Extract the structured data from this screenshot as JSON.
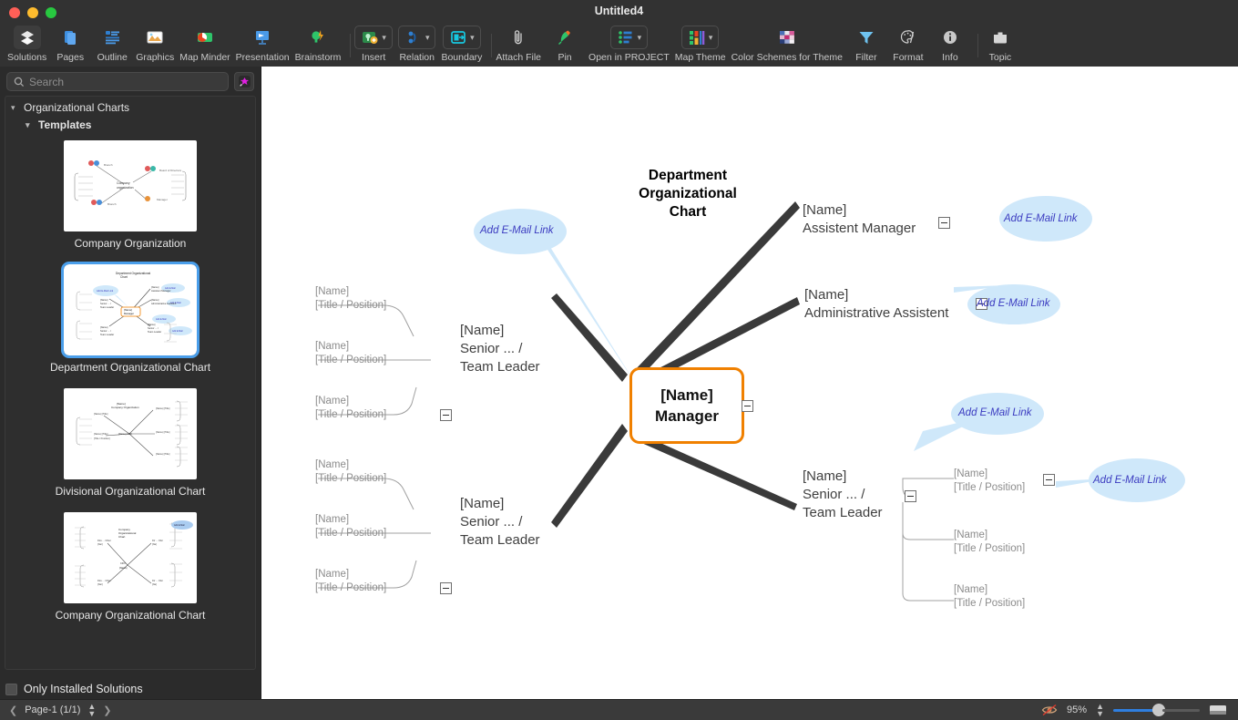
{
  "window": {
    "title": "Untitled4"
  },
  "toolbar": {
    "items": [
      {
        "label": "Solutions",
        "icon": "solutions-icon",
        "active": true,
        "chevron": false
      },
      {
        "label": "Pages",
        "icon": "pages-icon",
        "active": false,
        "chevron": false
      },
      {
        "label": "Outline",
        "icon": "outline-icon",
        "active": false,
        "chevron": false
      },
      {
        "label": "Graphics",
        "icon": "graphics-icon",
        "active": false,
        "chevron": false
      },
      {
        "label": "Map Minder",
        "icon": "map-minder-icon",
        "active": false,
        "chevron": false
      },
      {
        "label": "Presentation",
        "icon": "presentation-icon",
        "active": false,
        "chevron": false
      },
      {
        "label": "Brainstorm",
        "icon": "brainstorm-icon",
        "active": false,
        "chevron": false
      },
      {
        "label": "Insert",
        "icon": "insert-icon",
        "active": false,
        "chevron": true
      },
      {
        "label": "Relation",
        "icon": "relation-icon",
        "active": false,
        "chevron": true
      },
      {
        "label": "Boundary",
        "icon": "boundary-icon",
        "active": false,
        "chevron": true
      },
      {
        "label": "Attach File",
        "icon": "paperclip-icon",
        "active": false,
        "chevron": false
      },
      {
        "label": "Pin",
        "icon": "pin-icon",
        "active": false,
        "chevron": false
      },
      {
        "label": "Open in PROJECT",
        "icon": "open-in-project-icon",
        "active": false,
        "chevron": true
      },
      {
        "label": "Map Theme",
        "icon": "map-theme-icon",
        "active": false,
        "chevron": true
      },
      {
        "label": "Color Schemes for Theme",
        "icon": "color-schemes-icon",
        "active": false,
        "chevron": false
      },
      {
        "label": "Filter",
        "icon": "filter-icon",
        "active": false,
        "chevron": false
      },
      {
        "label": "Format",
        "icon": "format-icon",
        "active": false,
        "chevron": false
      },
      {
        "label": "Info",
        "icon": "info-icon",
        "active": false,
        "chevron": false
      },
      {
        "label": "Topic",
        "icon": "topic-icon",
        "active": false,
        "chevron": false
      }
    ]
  },
  "sidebar": {
    "search": {
      "placeholder": "Search",
      "value": ""
    },
    "wand_icon": "magic-wand-icon",
    "tree": {
      "root": "Organizational Charts",
      "group": "Templates"
    },
    "templates": [
      {
        "label": "Company Organization",
        "selected": false
      },
      {
        "label": "Department Organizational Chart",
        "selected": true
      },
      {
        "label": "Divisional Organizational Chart",
        "selected": false
      },
      {
        "label": "Company Organizational Chart",
        "selected": false
      }
    ],
    "only_installed": {
      "label": "Only Installed Solutions",
      "checked": false
    }
  },
  "statusbar": {
    "prev_icon": "chevron-left-icon",
    "next_icon": "chevron-right-icon",
    "page_label": "Page-1 (1/1)",
    "eye_icon": "eye-off-icon",
    "zoom": "95%",
    "fit_icon": "fit-page-icon"
  },
  "map": {
    "title": "Department\nOrganizational\nChart",
    "title_lines": [
      "Department",
      "Organizational",
      "Chart"
    ],
    "center": {
      "name": "[Name]",
      "role": "Manager"
    },
    "branches": [
      {
        "id": "assistent-manager",
        "side": "right",
        "name": "[Name]",
        "role": "Assistent Manager",
        "callout": "Add E-Mail Link"
      },
      {
        "id": "administrative-assistent",
        "side": "right",
        "name": "[Name]",
        "role": "Administrative Assistent",
        "callout": "Add E-Mail Link"
      },
      {
        "id": "senior-team-leader-right",
        "side": "right",
        "name": "[Name]",
        "role_line1": "Senior ... /",
        "role_line2": "Team Leader",
        "callout": "Add E-Mail Link",
        "children": [
          {
            "name": "[Name]",
            "title": "[Title / Position]",
            "callout": "Add E-Mail Link"
          },
          {
            "name": "[Name]",
            "title": "[Title / Position]"
          },
          {
            "name": "[Name]",
            "title": "[Title / Position]"
          }
        ]
      },
      {
        "id": "senior-team-leader-upper-left",
        "side": "left",
        "name": "[Name]",
        "role_line1": "Senior ... /",
        "role_line2": "Team Leader",
        "children": [
          {
            "name": "[Name]",
            "title": "[Title / Position]"
          },
          {
            "name": "[Name]",
            "title": "[Title / Position]"
          },
          {
            "name": "[Name]",
            "title": "[Title / Position]"
          }
        ]
      },
      {
        "id": "senior-team-leader-lower-left",
        "side": "left",
        "name": "[Name]",
        "role_line1": "Senior ... /",
        "role_line2": "Team Leader",
        "children": [
          {
            "name": "[Name]",
            "title": "[Title / Position]"
          },
          {
            "name": "[Name]",
            "title": "[Title / Position]"
          },
          {
            "name": "[Name]",
            "title": "[Title / Position]"
          }
        ]
      }
    ],
    "center_callout": "Add E-Mail Link",
    "colors": {
      "center_border": "#F08000",
      "branch_line": "#3a3a3a",
      "sub_line": "#9a9a9a",
      "callout_fill": "#CFE8FA",
      "callout_text": "#3b3bc0"
    }
  }
}
